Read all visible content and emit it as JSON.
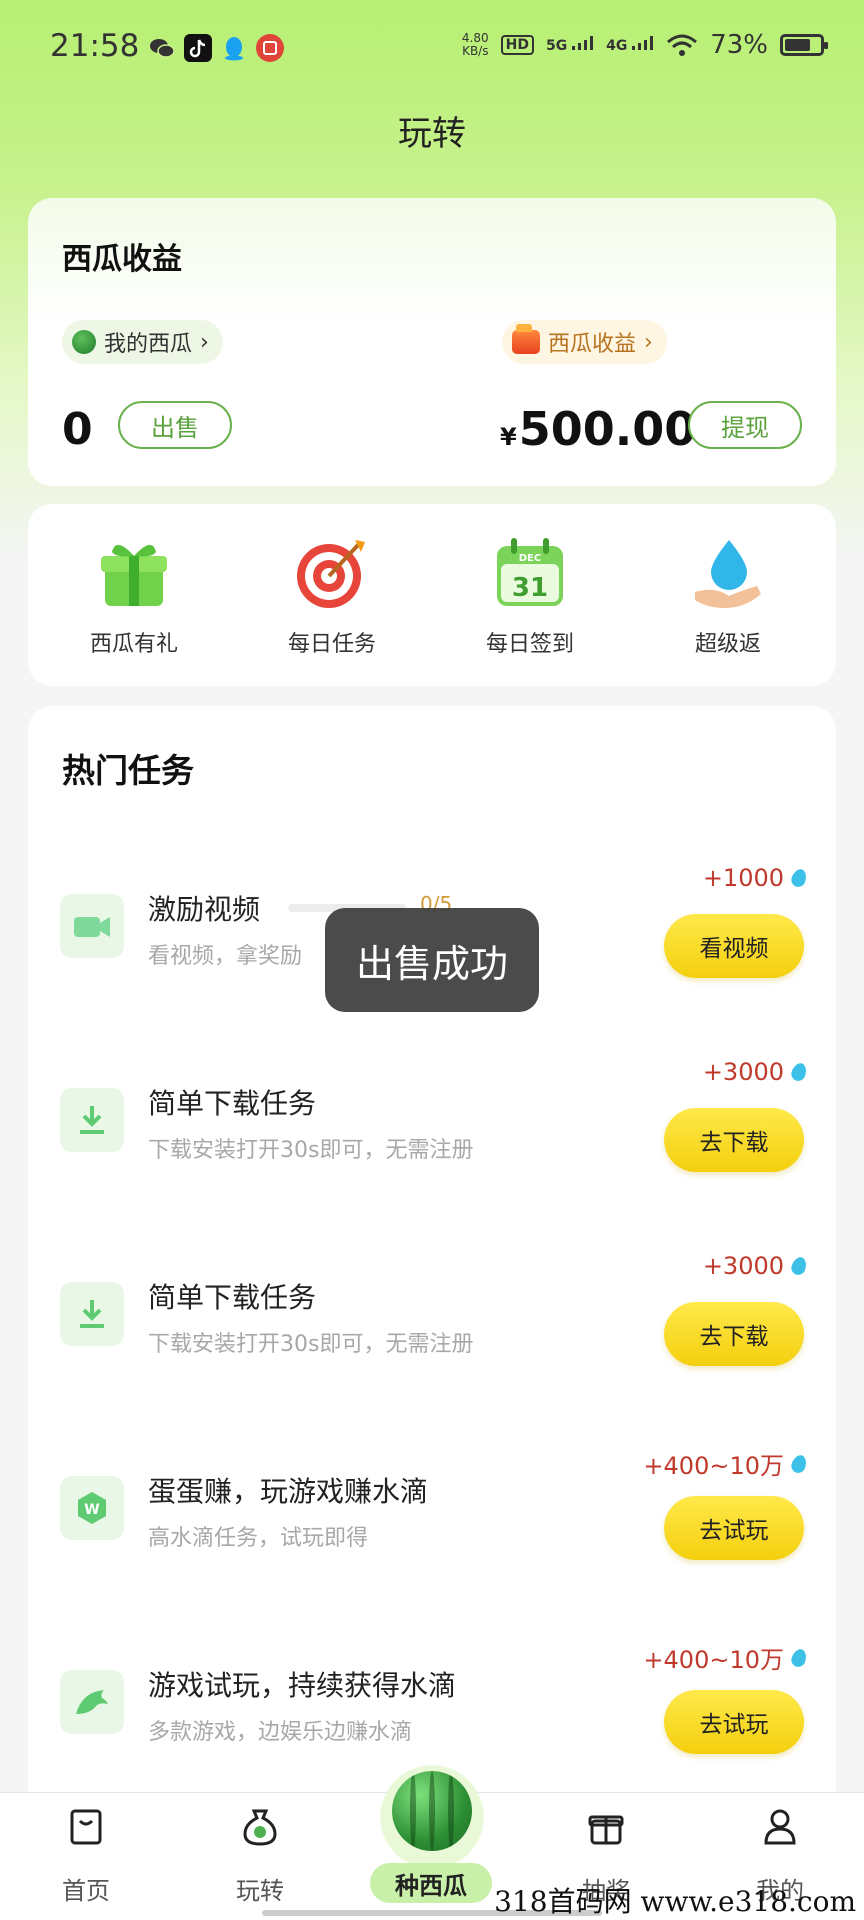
{
  "status_bar": {
    "time": "21:58",
    "net_speed": "4.80",
    "net_unit": "KB/s",
    "hd_label": "HD",
    "signal1": "5G",
    "signal2": "4G",
    "battery_percent": "73%",
    "battery_level": 0.73,
    "notification_icons": [
      "wechat-icon",
      "tiktok-icon",
      "qq-icon",
      "app-icon"
    ]
  },
  "header": {
    "title": "玩转"
  },
  "earnings": {
    "title": "西瓜收益",
    "my_melon_label": "我的西瓜",
    "melon_income_label": "西瓜收益",
    "melon_count": "0",
    "sell_button": "出售",
    "currency_symbol": "¥",
    "amount": "500.00",
    "withdraw_button": "提现"
  },
  "quick_actions": [
    {
      "label": "西瓜有礼",
      "icon": "gift-icon"
    },
    {
      "label": "每日任务",
      "icon": "target-icon"
    },
    {
      "label": "每日签到",
      "icon": "calendar-icon",
      "icon_month": "DEC",
      "icon_day": "31"
    },
    {
      "label": "超级返",
      "icon": "water-drop-hand-icon"
    }
  ],
  "tasks": {
    "section_title": "热门任务",
    "items": [
      {
        "name": "激励视频",
        "desc": "看视频，拿奖励",
        "reward": "+1000",
        "button": "看视频",
        "progress": "0/5",
        "progress_value": 0,
        "icon": "video-camera-icon"
      },
      {
        "name": "简单下载任务",
        "desc": "下载安装打开30s即可，无需注册",
        "reward": "+3000",
        "button": "去下载",
        "icon": "download-icon"
      },
      {
        "name": "简单下载任务",
        "desc": "下载安装打开30s即可，无需注册",
        "reward": "+3000",
        "button": "去下载",
        "icon": "download-icon"
      },
      {
        "name": "蛋蛋赚，玩游戏赚水滴",
        "desc": "高水滴任务，试玩即得",
        "reward": "+400~10万",
        "button": "去试玩",
        "icon": "game-hexagon-icon"
      },
      {
        "name": "游戏试玩，持续获得水滴",
        "desc": "多款游戏，边娱乐边赚水滴",
        "reward": "+400~10万",
        "button": "去试玩",
        "icon": "dolphin-icon"
      }
    ]
  },
  "toast": {
    "message": "出售成功"
  },
  "bottom_nav": {
    "items": [
      {
        "label": "首页",
        "icon": "home-bag-icon"
      },
      {
        "label": "玩转",
        "icon": "money-bag-icon"
      },
      {
        "label": "抽奖",
        "icon": "gift-box-icon"
      },
      {
        "label": "我的",
        "icon": "user-icon"
      }
    ],
    "center_label": "种西瓜"
  },
  "watermark": "318首码网  www.e318.com",
  "colors": {
    "accent_green": "#6ab04c",
    "reward_red": "#c0392b",
    "button_yellow": "#f4cf0e",
    "bg_green": "#b6ef72"
  }
}
